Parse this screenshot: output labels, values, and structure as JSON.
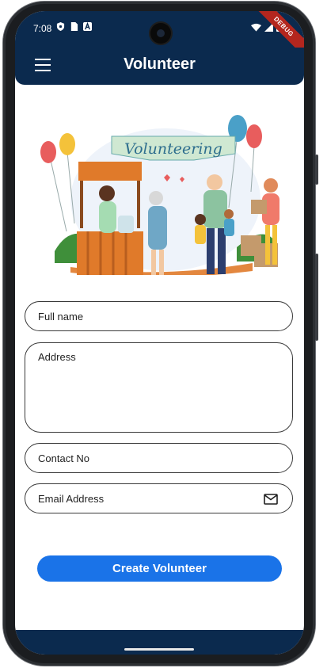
{
  "status_bar": {
    "time": "7:08",
    "left_icons": [
      "shield-icon",
      "sim-card-icon",
      "a-letter-icon"
    ],
    "right_icons": [
      "wifi-icon",
      "signal-icon",
      "battery-icon"
    ],
    "debug_label": "DEBUG"
  },
  "app_bar": {
    "title": "Volunteer",
    "menu_icon": "hamburger-menu-icon",
    "background": "#0b2a4e"
  },
  "illustration": {
    "banner_text": "Volunteering"
  },
  "form": {
    "full_name_label": "Full name",
    "address_label": "Address",
    "contact_label": "Contact No",
    "email_label": "Email Address",
    "email_icon": "mail-icon"
  },
  "actions": {
    "create_label": "Create Volunteer",
    "button_color": "#1a73e8"
  }
}
